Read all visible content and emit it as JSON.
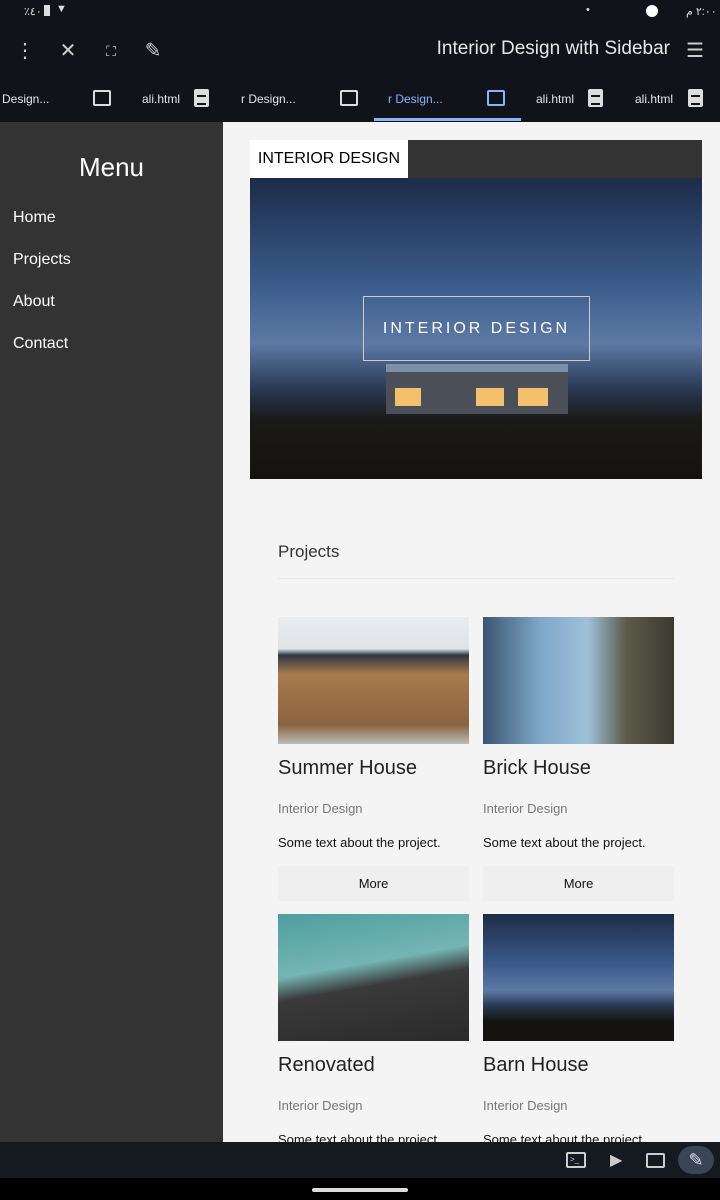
{
  "status_bar": {
    "left": "٪٤٠",
    "right": "٢:٠٠ م"
  },
  "toolbar": {
    "title": "Interior Design with Sidebar"
  },
  "tabs": [
    {
      "label": "Design..."
    },
    {
      "label": "ali.html"
    },
    {
      "label": "r Design..."
    },
    {
      "label": "r Design...",
      "active": true
    },
    {
      "label": "ali.html"
    },
    {
      "label": "ali.html"
    }
  ],
  "sidebar": {
    "title": "Menu",
    "items": [
      {
        "label": "Home"
      },
      {
        "label": "Projects"
      },
      {
        "label": "About"
      },
      {
        "label": "Contact"
      }
    ]
  },
  "header": {
    "label": "INTERIOR DESIGN"
  },
  "hero": {
    "label": "INTERIOR DESIGN"
  },
  "projects": {
    "heading": "Projects",
    "cards": [
      {
        "title": "Summer House",
        "subtitle": "Interior Design",
        "text": "Some text about the project.",
        "button": "More"
      },
      {
        "title": "Brick House",
        "subtitle": "Interior Design",
        "text": "Some text about the project.",
        "button": "More"
      },
      {
        "title": "Renovated",
        "subtitle": "Interior Design",
        "text": "Some text about the project."
      },
      {
        "title": "Barn House",
        "subtitle": "Interior Design",
        "text": "Some text about the project."
      }
    ]
  },
  "colors": {
    "accent": "#8ab4f8",
    "sidebar": "#333333"
  }
}
